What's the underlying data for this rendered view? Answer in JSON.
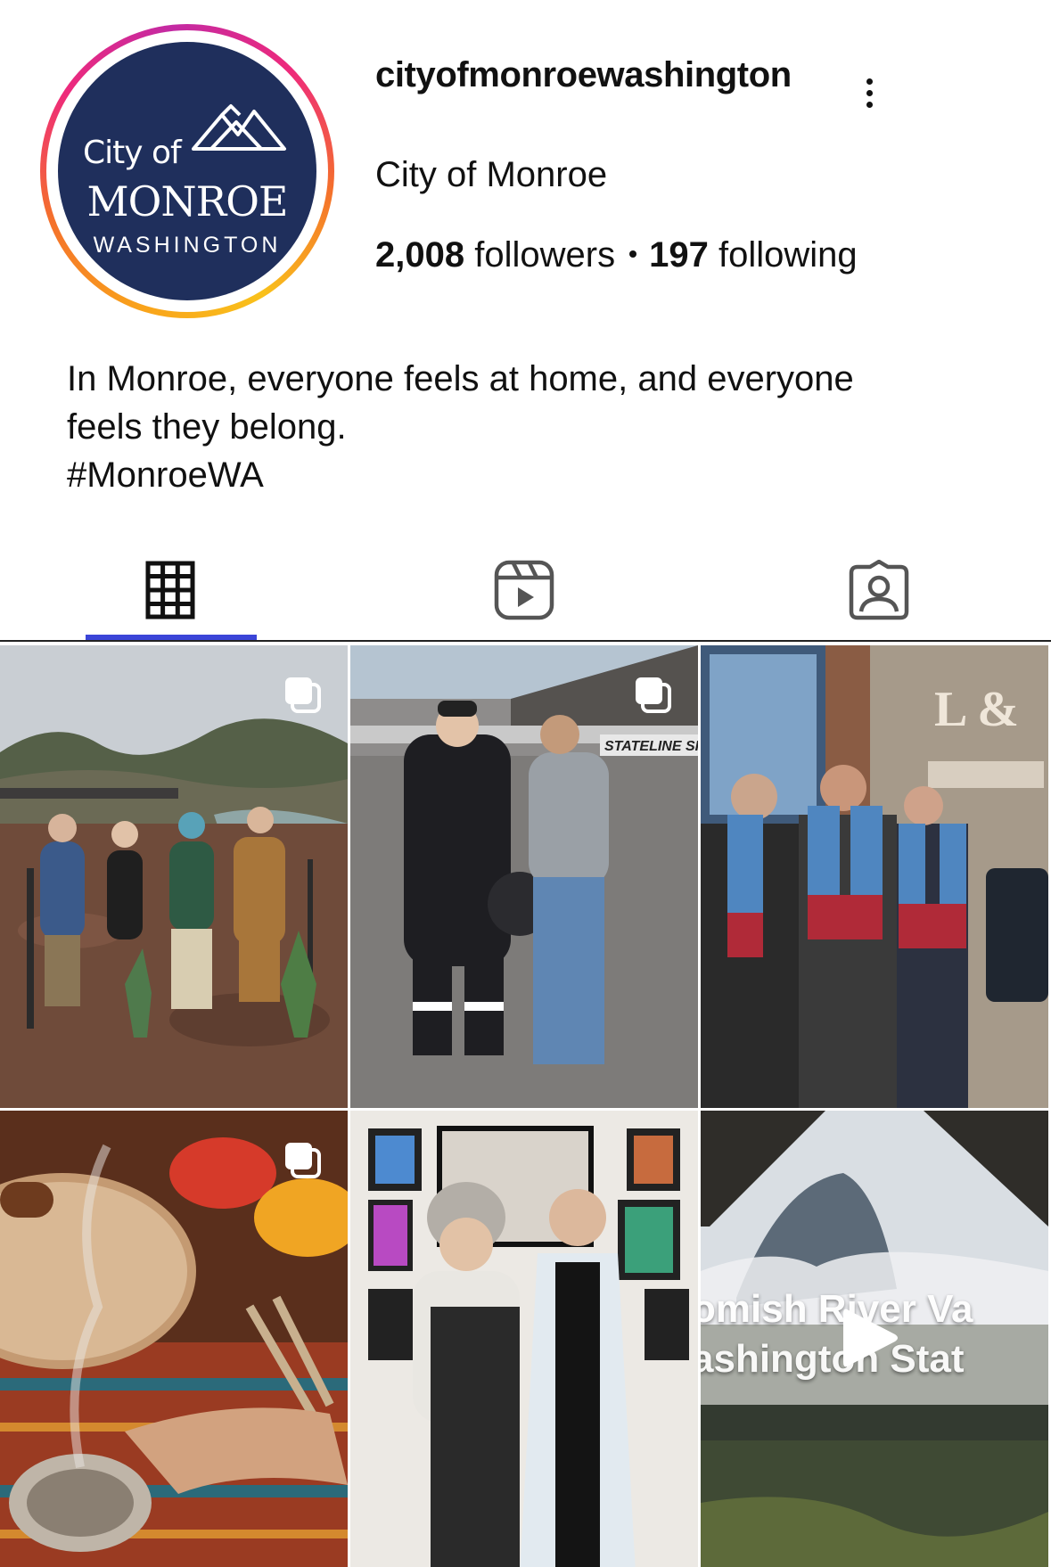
{
  "profile": {
    "username": "cityofmonroewashington",
    "display_name": "City of Monroe",
    "followers_count": "2,008",
    "followers_label": "followers",
    "following_count": "197",
    "following_label": "following",
    "bio": {
      "line1": "In Monroe, everyone feels at home, and everyone",
      "line2": "feels they belong.",
      "hashtag": "#MonroeWA"
    },
    "avatar": {
      "logo_line1": "City of",
      "logo_line2": "MONROE",
      "logo_line3": "WASHINGTON"
    }
  },
  "tabs": [
    {
      "icon": "grid-icon",
      "selected": true
    },
    {
      "icon": "reels-icon",
      "selected": false
    },
    {
      "icon": "tagged-icon",
      "selected": false
    }
  ],
  "colors": {
    "accent_tab": "#3b45d8",
    "avatar_bg": "#1f2f5c"
  },
  "posts": [
    {
      "type": "carousel",
      "icon": "multiple-posts-icon"
    },
    {
      "type": "carousel",
      "icon": "multiple-posts-icon",
      "sign_text": "STATELINE SP"
    },
    {
      "type": "photo",
      "sign_text": "L &"
    },
    {
      "type": "carousel",
      "icon": "multiple-posts-icon"
    },
    {
      "type": "photo"
    },
    {
      "type": "reel",
      "icon": "play-icon",
      "overlay_line1": "omish River Va",
      "overlay_line2": "ashington Stat"
    }
  ]
}
